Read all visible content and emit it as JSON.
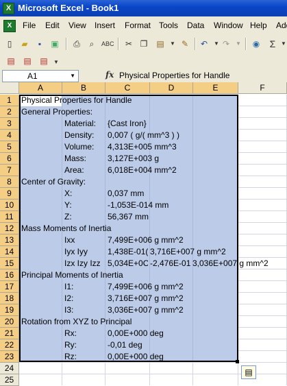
{
  "window": {
    "title": "Microsoft Excel - Book1",
    "app_icon": "excel-icon"
  },
  "menu": [
    "File",
    "Edit",
    "View",
    "Insert",
    "Format",
    "Tools",
    "Data",
    "Window",
    "Help",
    "Add"
  ],
  "formula_bar": {
    "name_box": "A1",
    "fx_label": "fx",
    "content": "Physical Properties for Handle"
  },
  "columns": [
    "A",
    "B",
    "C",
    "D",
    "E",
    "F"
  ],
  "rows": [
    "1",
    "2",
    "3",
    "4",
    "5",
    "6",
    "7",
    "8",
    "9",
    "10",
    "11",
    "12",
    "13",
    "14",
    "15",
    "16",
    "17",
    "18",
    "19",
    "20",
    "21",
    "22",
    "23",
    "24",
    "25"
  ],
  "cells": {
    "r1a": "Physical Properties for Handle",
    "r2a": "General Properties:",
    "r3b": "Material:",
    "r3c": "{Cast Iron}",
    "r4b": "Density:",
    "r4c": "0,007 ( g/( mm^3 ) )",
    "r5b": "Volume:",
    "r5c": "4,313E+005 mm^3",
    "r6b": "Mass:",
    "r6c": "3,127E+003 g",
    "r7b": "Area:",
    "r7c": "6,018E+004 mm^2",
    "r8a": "Center of Gravity:",
    "r9b": "X:",
    "r9c": "0,037 mm",
    "r10b": "Y:",
    "r10c": "-1,053E-014 mm",
    "r11b": "Z:",
    "r11c": "56,367 mm",
    "r12a": "Mass Moments of Inertia",
    "r13b": "Ixx",
    "r13c": "7,499E+006 g mm^2",
    "r14b": "Iyx Iyy",
    "r14c": "1,438E-01(",
    "r14d": "3,716E+007 g mm^2",
    "r15b": "Izx Izy Izz",
    "r15c": "5,034E+0C",
    "r15d": "-2,476E-01",
    "r15e": "3,036E+007 g mm^2",
    "r16a": "Principal Moments of Inertia",
    "r17b": "I1:",
    "r17c": "7,499E+006 g mm^2",
    "r18b": "I2:",
    "r18c": "3,716E+007 g mm^2",
    "r19b": "I3:",
    "r19c": "3,036E+007 g mm^2",
    "r20a": "Rotation from XYZ to Principal",
    "r21b": "Rx:",
    "r21c": "0,00E+000 deg",
    "r22b": "Ry:",
    "r22c": "-0,01 deg",
    "r23b": "Rz:",
    "r23c": "0,00E+000 deg"
  },
  "colors": {
    "titlebar": "#0a46c8",
    "selection_fill": "#bccbe8",
    "header_selected": "#f4ce84"
  },
  "toolbar_icons": [
    "new-icon",
    "open-icon",
    "save-icon",
    "permission-icon",
    "print-icon",
    "print-preview-icon",
    "spelling-icon",
    "cut-icon",
    "copy-icon",
    "paste-icon",
    "format-painter-icon",
    "undo-icon",
    "redo-icon",
    "hyperlink-icon",
    "autosum-icon"
  ],
  "toolbar2_icons": [
    "pdf-icon",
    "pdf-email-icon",
    "pdf-review-icon"
  ],
  "misc": {
    "paste_options_icon": "paste-options-icon"
  }
}
